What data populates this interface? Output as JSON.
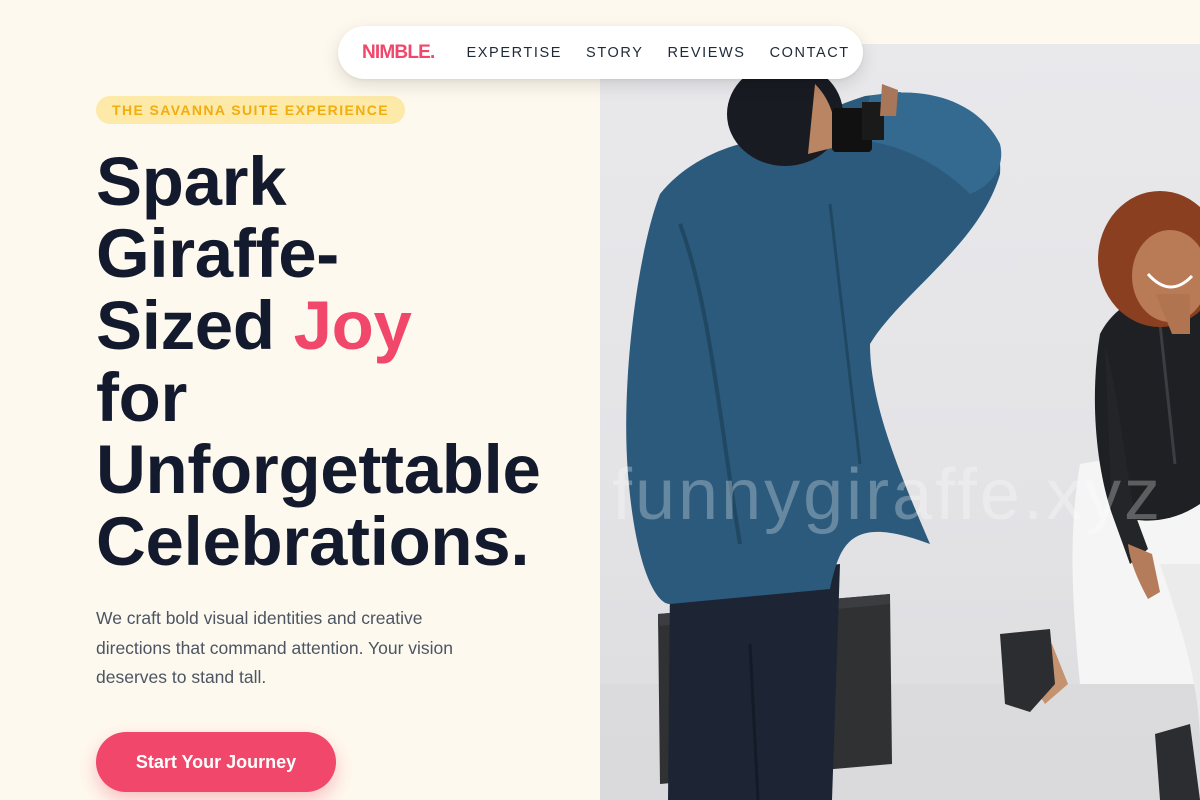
{
  "nav": {
    "logo": "NIMBLE.",
    "links": [
      "EXPERTISE",
      "STORY",
      "REVIEWS",
      "CONTACT"
    ]
  },
  "hero": {
    "badge": "THE SAVANNA SUITE EXPERIENCE",
    "headline_lines": [
      "Spark",
      "Giraffe-",
      "Sized",
      "Joy",
      "for",
      "Unforgettable",
      "Celebrations."
    ],
    "description": "We craft bold visual identities and creative directions that command attention. Your vision deserves to stand tall.",
    "cta_label": "Start Your Journey"
  },
  "image": {
    "description": "photographer-shooting-smiling-woman",
    "watermark": "funnygiraffe.xyz"
  },
  "colors": {
    "background": "#fef9ee",
    "accent": "#f0476b",
    "badge_bg": "#fde9a8",
    "badge_text": "#f2ad0e",
    "headline": "#131a2e",
    "body_text": "#4b5563"
  }
}
